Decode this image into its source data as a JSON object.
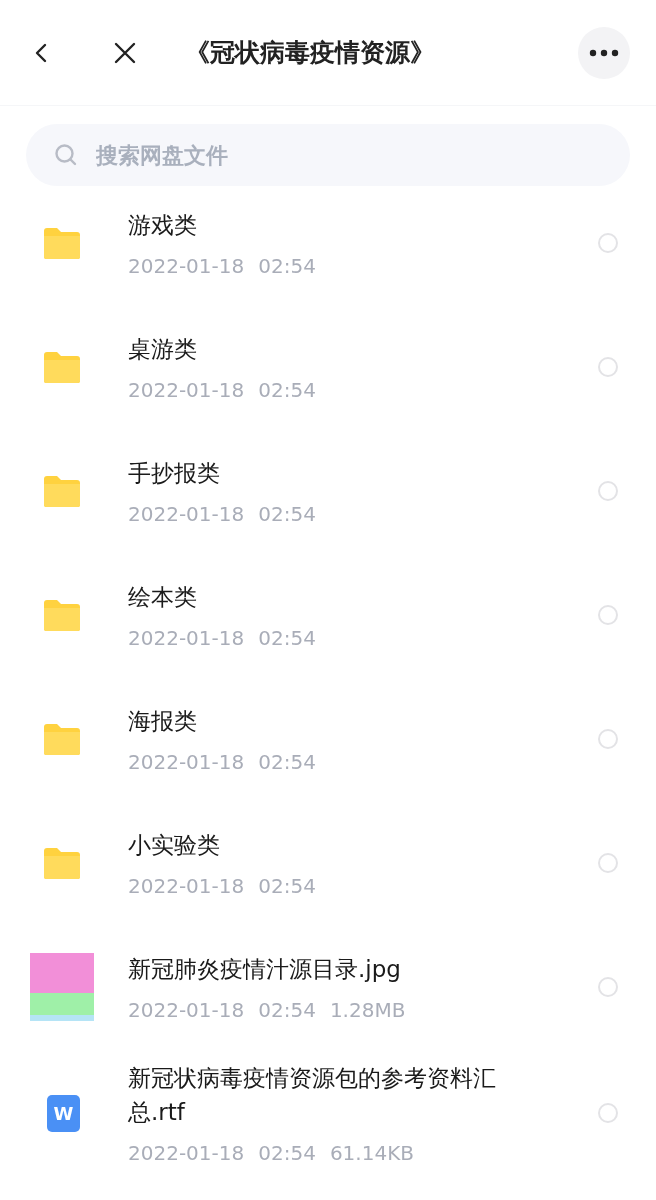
{
  "header": {
    "title": "《冠状病毒疫情资源》"
  },
  "search": {
    "placeholder": "搜索网盘文件"
  },
  "files": [
    {
      "kind": "folder",
      "name": "游戏类",
      "date": "2022-01-18",
      "time": "02:54",
      "selected": false
    },
    {
      "kind": "folder",
      "name": "桌游类",
      "date": "2022-01-18",
      "time": "02:54",
      "selected": false
    },
    {
      "kind": "folder",
      "name": "手抄报类",
      "date": "2022-01-18",
      "time": "02:54",
      "selected": false
    },
    {
      "kind": "folder",
      "name": "绘本类",
      "date": "2022-01-18",
      "time": "02:54",
      "selected": false
    },
    {
      "kind": "folder",
      "name": "海报类",
      "date": "2022-01-18",
      "time": "02:54",
      "selected": false
    },
    {
      "kind": "folder",
      "name": "小实验类",
      "date": "2022-01-18",
      "time": "02:54",
      "selected": false
    },
    {
      "kind": "image",
      "name": "新冠肺炎疫情汁源目录.jpg",
      "date": "2022-01-18",
      "time": "02:54",
      "size": "1.28MB",
      "selected": false
    },
    {
      "kind": "doc",
      "icon_text": "W",
      "name": "新冠状病毒疫情资源包的参考资料汇总.rtf",
      "date": "2022-01-18",
      "time": "02:54",
      "size": "61.14KB",
      "selected": false
    }
  ]
}
